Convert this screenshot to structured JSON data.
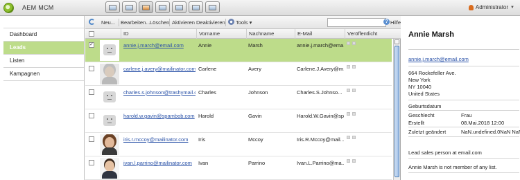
{
  "app": {
    "title": "AEM MCM",
    "user": "Administrator"
  },
  "nav": {
    "items": [
      "Dashboard",
      "Leads",
      "Listen",
      "Kampagnen"
    ],
    "selected": 1
  },
  "toolbar": {
    "new": "Neu...",
    "edit": "Bearbeiten...",
    "delete": "Löschen",
    "activate": "Aktivieren",
    "deactivate": "Deaktivieren",
    "tools": "Tools",
    "search_placeholder": "",
    "help": "Hilfe"
  },
  "grid": {
    "columns": [
      "ID",
      "Vorname",
      "Nachname",
      "E-Mail",
      "Veröffentlicht"
    ],
    "rows": [
      {
        "id": "annie.j.march@email.com",
        "first": "Annie",
        "last": "Marsh",
        "email": "annie.j.march@ema...",
        "avatar": "placeholder",
        "selected": true
      },
      {
        "id": "carlene.j.avery@mailinator.com",
        "first": "Carlene",
        "last": "Avery",
        "email": "Carlene.J.Avery@m...",
        "avatar": "photo-gray",
        "selected": false
      },
      {
        "id": "charles.s.johnson@trashymail.c...",
        "first": "Charles",
        "last": "Johnson",
        "email": "Charles.S.Johnso...",
        "avatar": "placeholder",
        "selected": false
      },
      {
        "id": "harold.w.gavin@spambob.com",
        "first": "Harold",
        "last": "Gavin",
        "email": "Harold.W.Gavin@sp...",
        "avatar": "placeholder",
        "selected": false
      },
      {
        "id": "iris.r.mccoy@mailinator.com",
        "first": "Iris",
        "last": "Mccoy",
        "email": "Iris.R.Mccoy@mail...",
        "avatar": "photo-brown",
        "selected": false
      },
      {
        "id": "ivan.l.parrino@mailinator.com",
        "first": "Ivan",
        "last": "Parrino",
        "email": "Ivan.L.Parrino@ma...",
        "avatar": "photo-dark",
        "selected": false
      }
    ]
  },
  "detail": {
    "name": "Annie Marsh",
    "email": "annie.j.march@email.com",
    "address": [
      "664 Rockefeller Ave.",
      "New York",
      "NY 10040",
      "United States"
    ],
    "fields": [
      {
        "label": "Geburtsdatum",
        "value": ""
      },
      {
        "label": "Geschlecht",
        "value": "Frau"
      },
      {
        "label": "Erstellt",
        "value": "08.Mai.2018 12:00"
      },
      {
        "label": "Zuletzt geändert",
        "value": "NaN.undefined.0NaN NaN"
      }
    ],
    "note": "Lead sales person at email.com",
    "lists_text": "Annie Marsh is not member of any list."
  },
  "colors": {
    "selection": "#bddc8a",
    "link": "#2a52a8",
    "brand": "#8dbf2c"
  },
  "icons": [
    "aem-logo-icon",
    "refresh-icon",
    "new-icon",
    "tools-icon",
    "help-icon",
    "user-icon"
  ]
}
